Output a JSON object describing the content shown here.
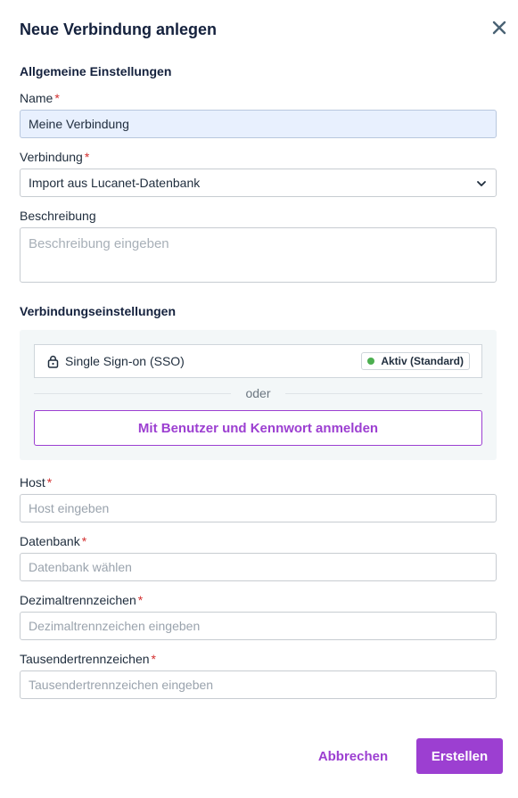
{
  "dialog": {
    "title": "Neue Verbindung anlegen",
    "close_icon": "close-icon"
  },
  "general": {
    "section_title": "Allgemeine Einstellungen",
    "name": {
      "label": "Name",
      "required_mark": "*",
      "value": "Meine Verbindung"
    },
    "connection": {
      "label": "Verbindung",
      "required_mark": "*",
      "selected": "Import aus Lucanet-Datenbank"
    },
    "description": {
      "label": "Beschreibung",
      "placeholder": "Beschreibung eingeben"
    }
  },
  "connection_settings": {
    "section_title": "Verbindungseinstellungen",
    "sso": {
      "icon": "lock-icon",
      "label": "Single Sign-on (SSO)",
      "status": "Aktiv (Standard)",
      "status_color": "#4caf50"
    },
    "divider_text": "oder",
    "login_button": "Mit Benutzer und Kennwort anmelden",
    "host": {
      "label": "Host",
      "required_mark": "*",
      "placeholder": "Host eingeben"
    },
    "database": {
      "label": "Datenbank",
      "required_mark": "*",
      "placeholder": "Datenbank wählen"
    },
    "decimal_separator": {
      "label": "Dezimaltrennzeichen",
      "required_mark": "*",
      "placeholder": "Dezimaltrennzeichen eingeben"
    },
    "thousands_separator": {
      "label": "Tausendertrennzeichen",
      "required_mark": "*",
      "placeholder": "Tausendertrennzeichen eingeben"
    }
  },
  "footer": {
    "cancel": "Abbrechen",
    "create": "Erstellen"
  },
  "colors": {
    "accent": "#9c3fd1",
    "required": "#d32f2f",
    "filled_input_bg": "#e8f0fe"
  }
}
